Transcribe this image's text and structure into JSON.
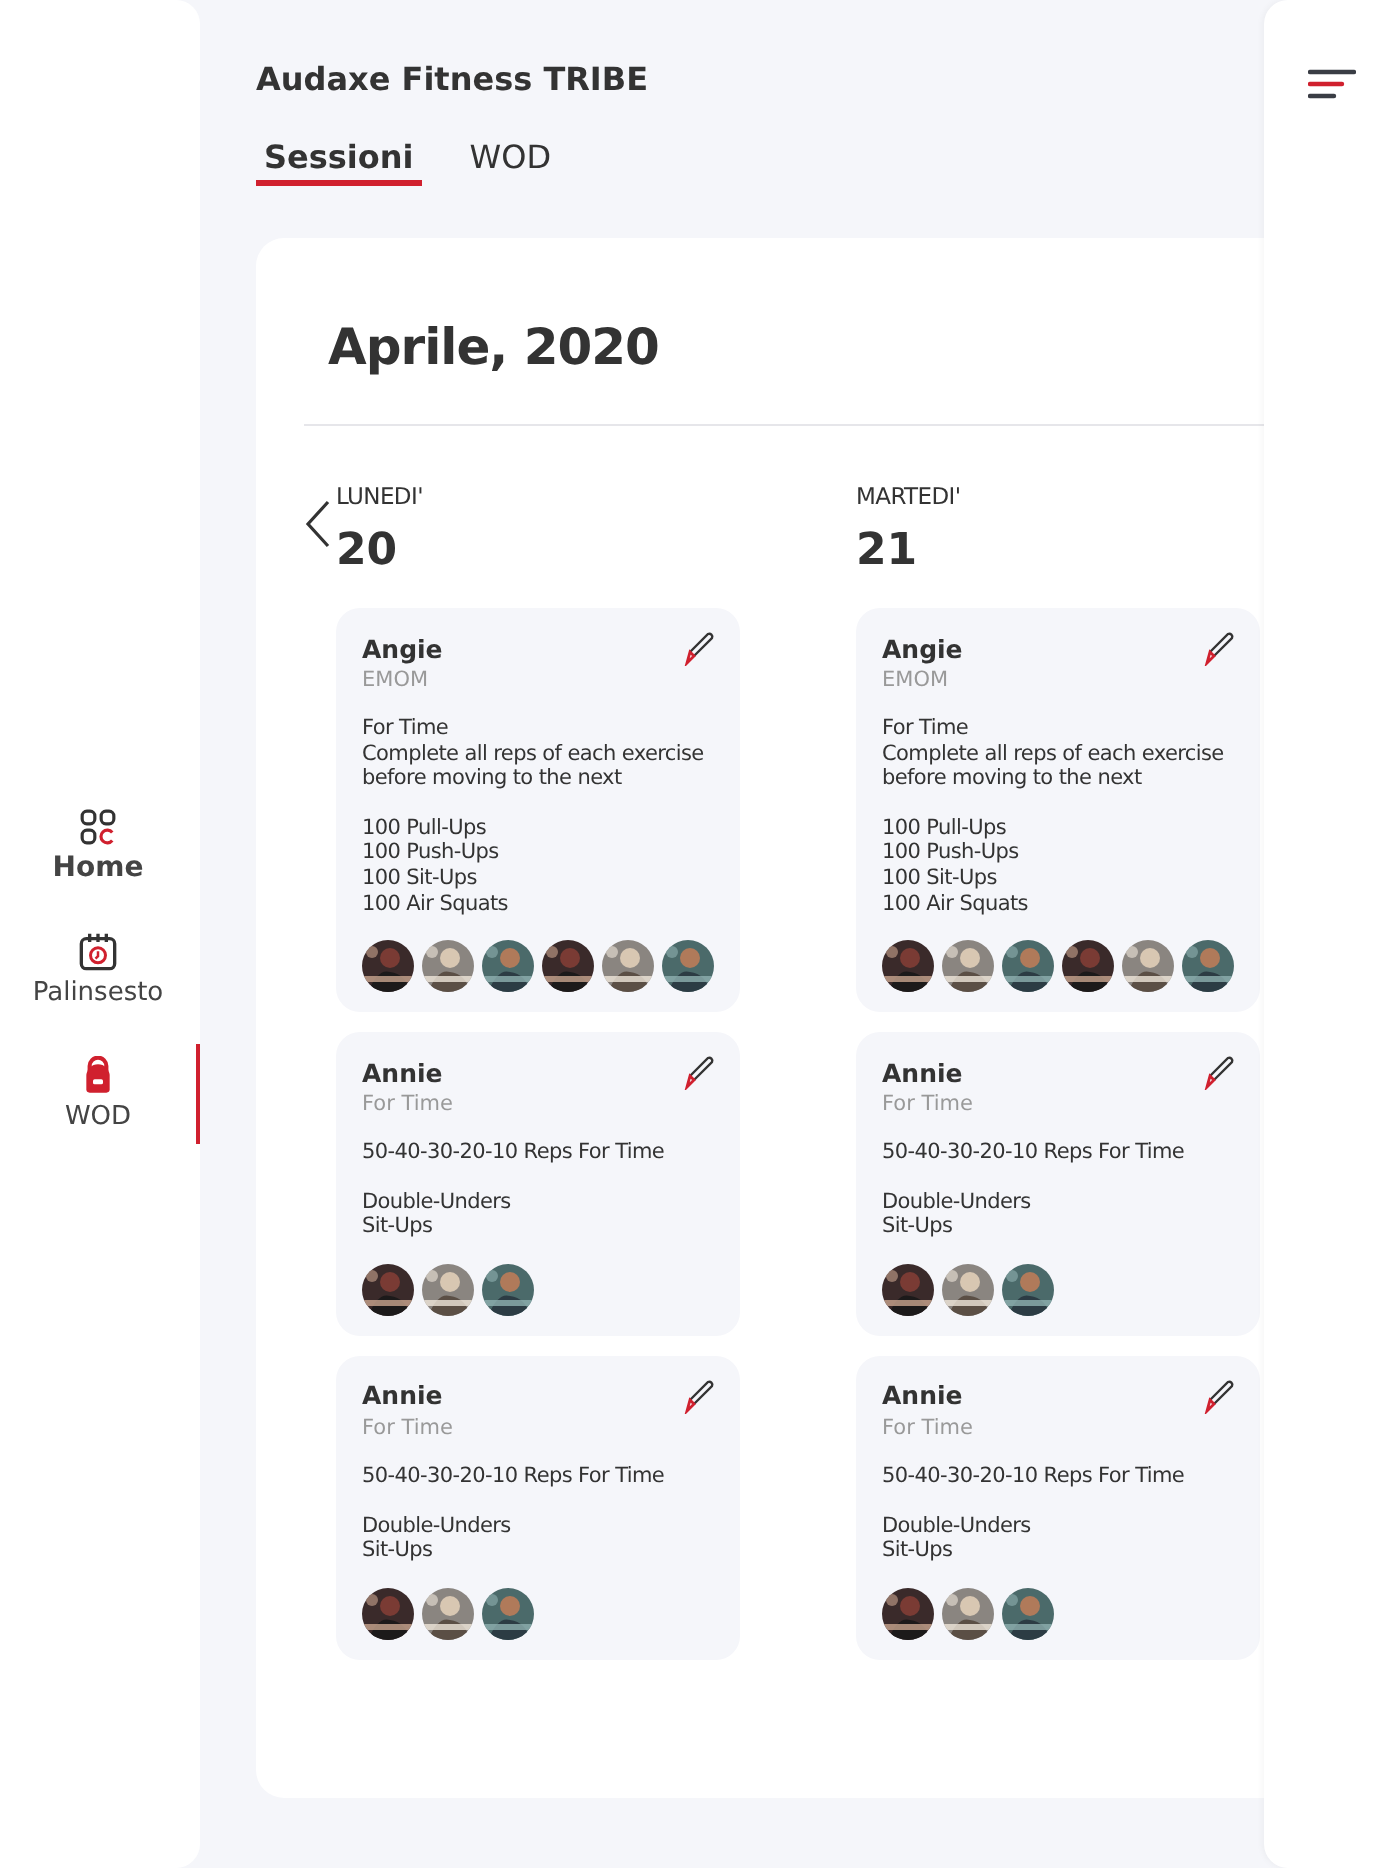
{
  "sidebar": {
    "items": [
      {
        "label": "Home",
        "kind": "home",
        "selected": false
      },
      {
        "label": "Palinsesto",
        "kind": "calendar",
        "selected": false
      },
      {
        "label": "WOD",
        "kind": "kettlebell",
        "selected": true
      }
    ]
  },
  "header": {
    "title": "Audaxe Fitness TRIBE"
  },
  "tabs": [
    {
      "label": "Sessioni",
      "selected": true
    },
    {
      "label": "WOD",
      "selected": false
    }
  ],
  "calendar": {
    "month": "Aprile, 2020",
    "days": [
      {
        "weekday": "LUNEDI'",
        "date": "20",
        "sessions": [
          {
            "name": "Angie",
            "type": "EMOM",
            "description": [
              "For Time",
              "Complete all reps of each exercise before moving to the next"
            ],
            "exercises": [
              "100 Pull-Ups",
              "100 Push-Ups",
              "100 Sit-Ups",
              "100 Air Squats"
            ],
            "participants": [
              {
                "kind": "picture"
              },
              {
                "kind": "picture"
              },
              {
                "kind": "picture"
              },
              {
                "kind": "picture"
              },
              {
                "kind": "picture"
              },
              {
                "kind": "picture"
              }
            ]
          },
          {
            "name": "Annie",
            "type": "For Time",
            "description": [
              "50-40-30-20-10 Reps For Time"
            ],
            "exercises": [
              "Double-Unders",
              "Sit-Ups"
            ],
            "participants": [
              {
                "kind": "picture"
              },
              {
                "kind": "picture"
              },
              {
                "kind": "picture"
              }
            ]
          },
          {
            "name": "Annie",
            "type": "For Time",
            "description": [
              "50-40-30-20-10 Reps For Time"
            ],
            "exercises": [
              "Double-Unders",
              "Sit-Ups"
            ],
            "participants": [
              {
                "kind": "picture"
              },
              {
                "kind": "picture"
              },
              {
                "kind": "picture"
              }
            ]
          }
        ]
      },
      {
        "weekday": "MARTEDI'",
        "date": "21",
        "sessions": [
          {
            "name": "Angie",
            "type": "EMOM",
            "description": [
              "For Time",
              "Complete all reps of each exercise before moving to the next"
            ],
            "exercises": [
              "100 Pull-Ups",
              "100 Push-Ups",
              "100 Sit-Ups",
              "100 Air Squats"
            ],
            "participants": [
              {
                "kind": "picture"
              },
              {
                "kind": "picture"
              },
              {
                "kind": "picture"
              },
              {
                "kind": "picture"
              },
              {
                "kind": "picture"
              },
              {
                "kind": "picture"
              }
            ]
          },
          {
            "name": "Annie",
            "type": "For Time",
            "description": [
              "50-40-30-20-10 Reps For Time"
            ],
            "exercises": [
              "Double-Unders",
              "Sit-Ups"
            ],
            "participants": [
              {
                "kind": "picture"
              },
              {
                "kind": "picture"
              },
              {
                "kind": "picture"
              }
            ]
          },
          {
            "name": "Annie",
            "type": "For Time",
            "description": [
              "50-40-30-20-10 Reps For Time"
            ],
            "exercises": [
              "Double-Unders",
              "Sit-Ups"
            ],
            "participants": [
              {
                "kind": "picture"
              },
              {
                "kind": "picture"
              },
              {
                "kind": "picture"
              }
            ]
          }
        ]
      }
    ]
  }
}
